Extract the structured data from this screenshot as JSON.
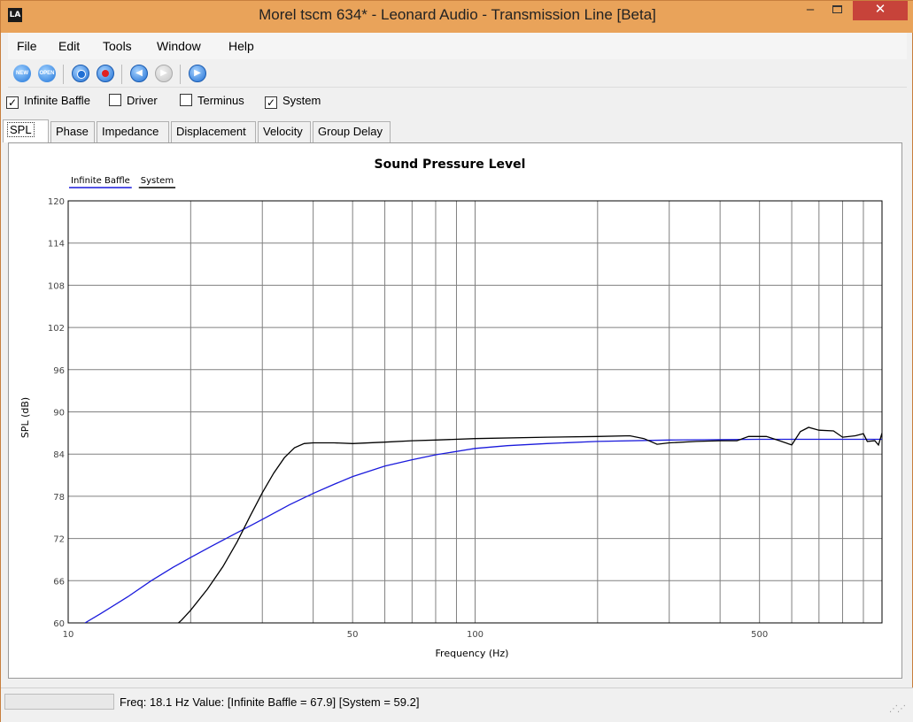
{
  "window": {
    "title": "Morel tscm  634* - Leonard Audio - Transmission Line [Beta]",
    "app_icon_text": "LA",
    "minimize": "–",
    "close": "✕"
  },
  "menu": [
    "File",
    "Edit",
    "Tools",
    "Window",
    "Help"
  ],
  "toolbar": {
    "new_label": "NEW",
    "open_label": "OPEN",
    "prev_glyph": "◀",
    "next_glyph": "▶",
    "play_glyph": "▶"
  },
  "checkboxes": [
    {
      "label": "Infinite Baffle",
      "checked": true
    },
    {
      "label": "Driver",
      "checked": false
    },
    {
      "label": "Terminus",
      "checked": false
    },
    {
      "label": "System",
      "checked": true
    }
  ],
  "tabs": [
    "SPL",
    "Phase",
    "Impedance",
    "Displacement",
    "Velocity",
    "Group Delay"
  ],
  "active_tab": "SPL",
  "status": {
    "text": "Freq: 18.1 Hz  Value: [Infinite Baffle = 67.9]  [System = 59.2]"
  },
  "chart_data": {
    "type": "line",
    "title": "Sound Pressure Level",
    "xlabel": "Frequency (Hz)",
    "ylabel": "SPL (dB)",
    "xscale": "log",
    "xlim": [
      10,
      1000
    ],
    "ylim": [
      60,
      120
    ],
    "x_tick_labels": [
      {
        "value": 10,
        "label": "10"
      },
      {
        "value": 50,
        "label": "50"
      },
      {
        "value": 100,
        "label": "100"
      },
      {
        "value": 500,
        "label": "500"
      }
    ],
    "y_ticks": [
      60,
      66,
      72,
      78,
      84,
      90,
      96,
      102,
      108,
      114,
      120
    ],
    "grid": true,
    "legend_position": "top-left",
    "series": [
      {
        "name": "Infinite Baffle",
        "color": "#1a1adc",
        "points": [
          [
            11,
            60
          ],
          [
            12,
            61.3
          ],
          [
            14,
            63.7
          ],
          [
            16,
            66.0
          ],
          [
            18.1,
            67.9
          ],
          [
            20,
            69.3
          ],
          [
            22.5,
            70.9
          ],
          [
            25,
            72.3
          ],
          [
            28,
            73.8
          ],
          [
            30,
            74.7
          ],
          [
            35,
            76.8
          ],
          [
            40,
            78.4
          ],
          [
            45,
            79.7
          ],
          [
            50,
            80.8
          ],
          [
            60,
            82.3
          ],
          [
            70,
            83.2
          ],
          [
            80,
            83.9
          ],
          [
            100,
            84.8
          ],
          [
            120,
            85.2
          ],
          [
            150,
            85.5
          ],
          [
            200,
            85.8
          ],
          [
            300,
            86.0
          ],
          [
            500,
            86.1
          ],
          [
            700,
            86.1
          ],
          [
            1000,
            86.1
          ]
        ]
      },
      {
        "name": "System",
        "color": "#000000",
        "points": [
          [
            18,
            59.2
          ],
          [
            19,
            60.4
          ],
          [
            20,
            61.8
          ],
          [
            22,
            64.8
          ],
          [
            24,
            68.0
          ],
          [
            26,
            71.5
          ],
          [
            28,
            75.2
          ],
          [
            30,
            78.5
          ],
          [
            32,
            81.3
          ],
          [
            34,
            83.5
          ],
          [
            36,
            84.9
          ],
          [
            38,
            85.5
          ],
          [
            40,
            85.6
          ],
          [
            45,
            85.6
          ],
          [
            50,
            85.5
          ],
          [
            60,
            85.7
          ],
          [
            70,
            85.9
          ],
          [
            80,
            86.0
          ],
          [
            100,
            86.2
          ],
          [
            150,
            86.4
          ],
          [
            200,
            86.5
          ],
          [
            240,
            86.6
          ],
          [
            260,
            86.2
          ],
          [
            280,
            85.4
          ],
          [
            300,
            85.6
          ],
          [
            350,
            85.8
          ],
          [
            400,
            85.9
          ],
          [
            440,
            85.9
          ],
          [
            470,
            86.5
          ],
          [
            520,
            86.5
          ],
          [
            560,
            85.9
          ],
          [
            600,
            85.3
          ],
          [
            630,
            87.2
          ],
          [
            660,
            87.8
          ],
          [
            700,
            87.4
          ],
          [
            760,
            87.3
          ],
          [
            800,
            86.4
          ],
          [
            860,
            86.6
          ],
          [
            900,
            86.9
          ],
          [
            920,
            85.8
          ],
          [
            960,
            85.9
          ],
          [
            980,
            85.3
          ],
          [
            1000,
            87.0
          ]
        ]
      }
    ]
  }
}
